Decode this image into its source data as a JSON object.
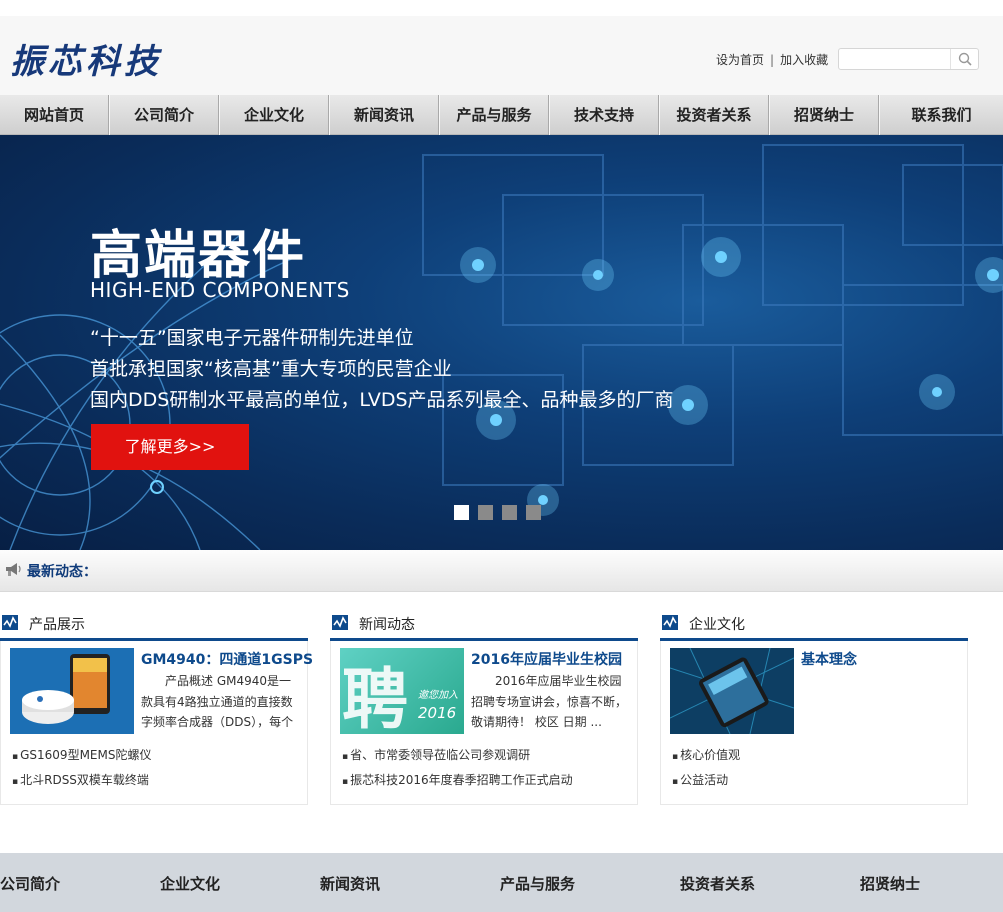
{
  "header": {
    "logo_text": "振芯科技",
    "set_home": "设为首页",
    "separator": "|",
    "favorite": "加入收藏",
    "search_placeholder": ""
  },
  "nav": {
    "items": [
      "网站首页",
      "公司简介",
      "企业文化",
      "新闻资讯",
      "产品与服务",
      "技术支持",
      "投资者关系",
      "招贤纳士",
      "联系我们"
    ]
  },
  "banner": {
    "title": "高端器件",
    "subtitle": "HIGH-END COMPONENTS",
    "line1": "“十一五”国家电子元器件研制先进单位",
    "line2": "首批承担国家“核高基”重大专项的民营企业",
    "line3": "国内DDS研制水平最高的单位，LVDS产品系列最全、品种最多的厂商",
    "more_button": "了解更多>>",
    "slide_count": 4,
    "active_slide": 1
  },
  "latest": {
    "label": "最新动态："
  },
  "columns": [
    {
      "title": "产品展示",
      "item_title": "GM4940：四通道1GSPS",
      "item_desc": "产品概述 GM4940是一款具有4路独立通道的直接数字频率合成器（DDS），每个通",
      "list": [
        "GS1609型MEMS陀螺仪",
        "北斗RDSS双模车载终端"
      ]
    },
    {
      "title": "新闻动态",
      "item_title": "2016年应届毕业生校园",
      "item_desc": "2016年应届毕业生校园招聘专场宣讲会，惊喜不断，敬请期待！ 校区 日期 ...",
      "thumb_big": "聘",
      "thumb_small": "邀您加入",
      "thumb_year": "2016",
      "list": [
        "省、市常委领导莅临公司参观调研",
        "振芯科技2016年度春季招聘工作正式启动"
      ]
    },
    {
      "title": "企业文化",
      "item_title": "基本理念",
      "item_desc": "",
      "list": [
        "核心价值观",
        "公益活动"
      ]
    }
  ],
  "footer": {
    "columns": [
      "公司简介",
      "企业文化",
      "新闻资讯",
      "产品与服务",
      "投资者关系",
      "招贤纳士"
    ]
  },
  "colors": {
    "brand_blue": "#0e4a8c",
    "cta_red": "#e1120f",
    "banner_dark": "#0a2c5a"
  },
  "icons": [
    "search-icon",
    "megaphone-icon",
    "chart-icon"
  ]
}
